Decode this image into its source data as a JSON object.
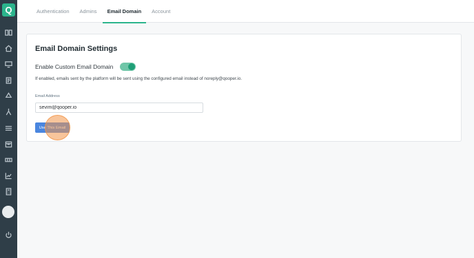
{
  "sidebar": {
    "logo_text": "Q",
    "icons": [
      "book-icon",
      "home-icon",
      "screen-icon",
      "clipboard-icon",
      "recycle-icon",
      "person-icon",
      "list-icon",
      "calendar-icon",
      "grid-icon",
      "chart-icon",
      "calculator-icon",
      "power-icon"
    ]
  },
  "tabs": [
    {
      "label": "Authentication",
      "active": false
    },
    {
      "label": "Admins",
      "active": false
    },
    {
      "label": "Email Domain",
      "active": true
    },
    {
      "label": "Account",
      "active": false
    }
  ],
  "card": {
    "title": "Email Domain Settings",
    "toggle_label": "Enable Custom Email Domain",
    "toggle_on": true,
    "help_text": "If enabled, emails sent by the platform will be sent using the configured email instead of noreply@qooper.io.",
    "field_label": "Email Address",
    "email_value": "sevim@qooper.io",
    "button_label": "Use This Email"
  },
  "colors": {
    "sidebar_bg": "#2f3e48",
    "accent_green": "#2bb48c",
    "button_blue": "#4a86df",
    "click_highlight": "#f39648"
  }
}
